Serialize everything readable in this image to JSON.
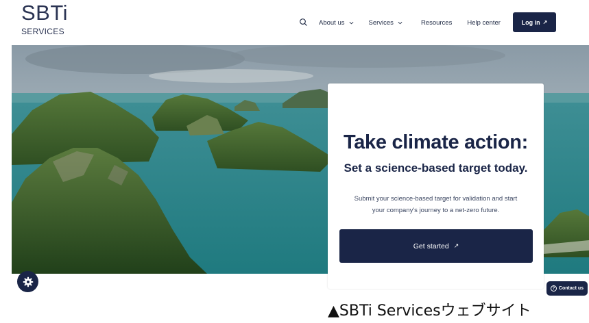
{
  "header": {
    "logo_main": "SBTi",
    "logo_sub": "SERVICES",
    "nav": {
      "search_icon": "search-icon",
      "about": "About us",
      "services": "Services",
      "resources": "Resources",
      "help": "Help center"
    },
    "login_label": "Log in",
    "arrow_glyph": "↗"
  },
  "hero": {
    "title": "Take climate action:",
    "subtitle": "Set a science-based target today.",
    "body_line1": "Submit your science-based target for validation and start",
    "body_line2": "your company's journey to a net-zero future.",
    "cta_label": "Get started"
  },
  "floating": {
    "settings_icon": "gear-icon",
    "contact_label": "Contact us",
    "contact_icon": "question-circle-icon"
  },
  "caption": "▲SBTi Servicesウェブサイト",
  "colors": {
    "brand_navy": "#1a2547",
    "text_dark": "#1f2a44",
    "background": "#ffffff"
  }
}
